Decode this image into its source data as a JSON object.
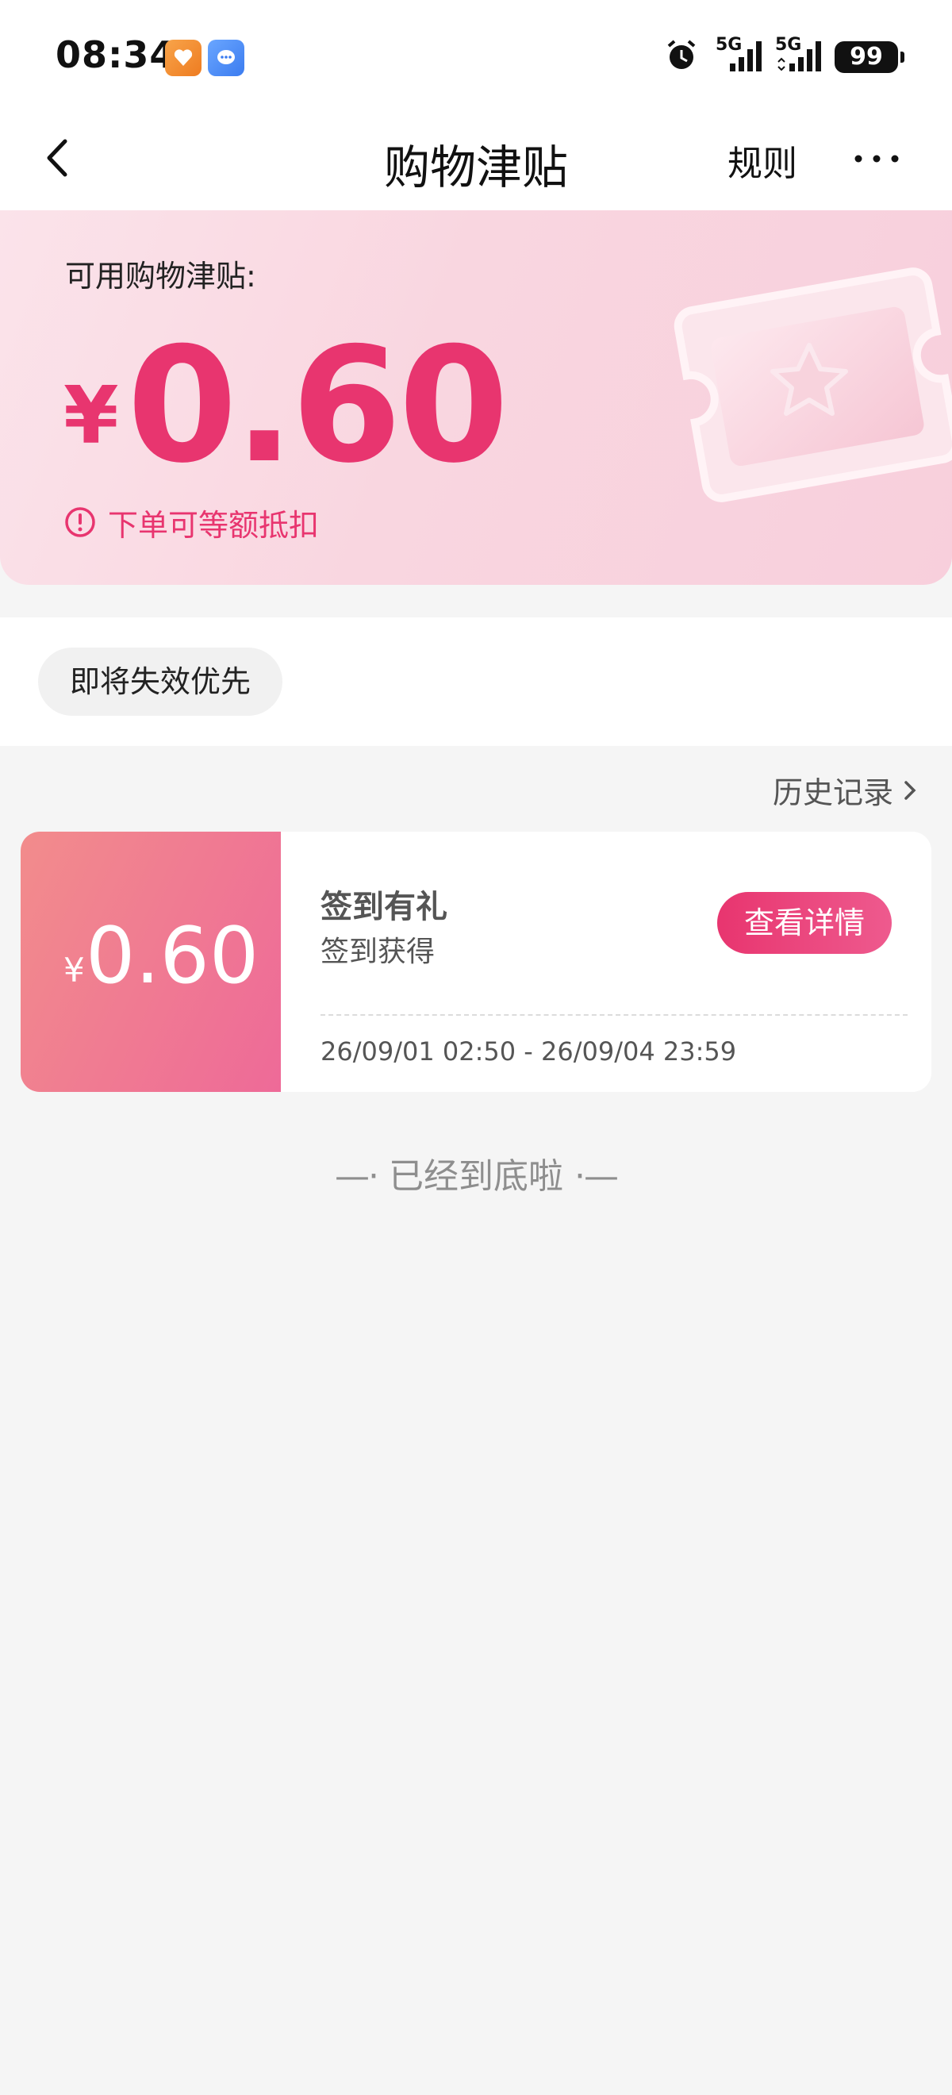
{
  "status_bar": {
    "time": "08:34",
    "signal_1": "5G",
    "signal_2": "5G",
    "battery": "99"
  },
  "nav": {
    "title": "购物津贴",
    "rules": "规则"
  },
  "balance": {
    "label": "可用购物津贴:",
    "currency": "¥",
    "amount": "0.60",
    "note": "下单可等额抵扣"
  },
  "filter": {
    "chip": "即将失效优先"
  },
  "history": {
    "label": "历史记录"
  },
  "subsidy_card": {
    "currency": "¥",
    "amount": "0.60",
    "title": "签到有礼",
    "subtitle": "签到获得",
    "button": "查看详情",
    "validity": "26/09/01 02:50 - 26/09/04 23:59"
  },
  "end_marker": "已经到底啦",
  "colors": {
    "accent": "#e8356f",
    "card_gradient_start": "#f28c8c",
    "card_gradient_end": "#ee6a98"
  }
}
